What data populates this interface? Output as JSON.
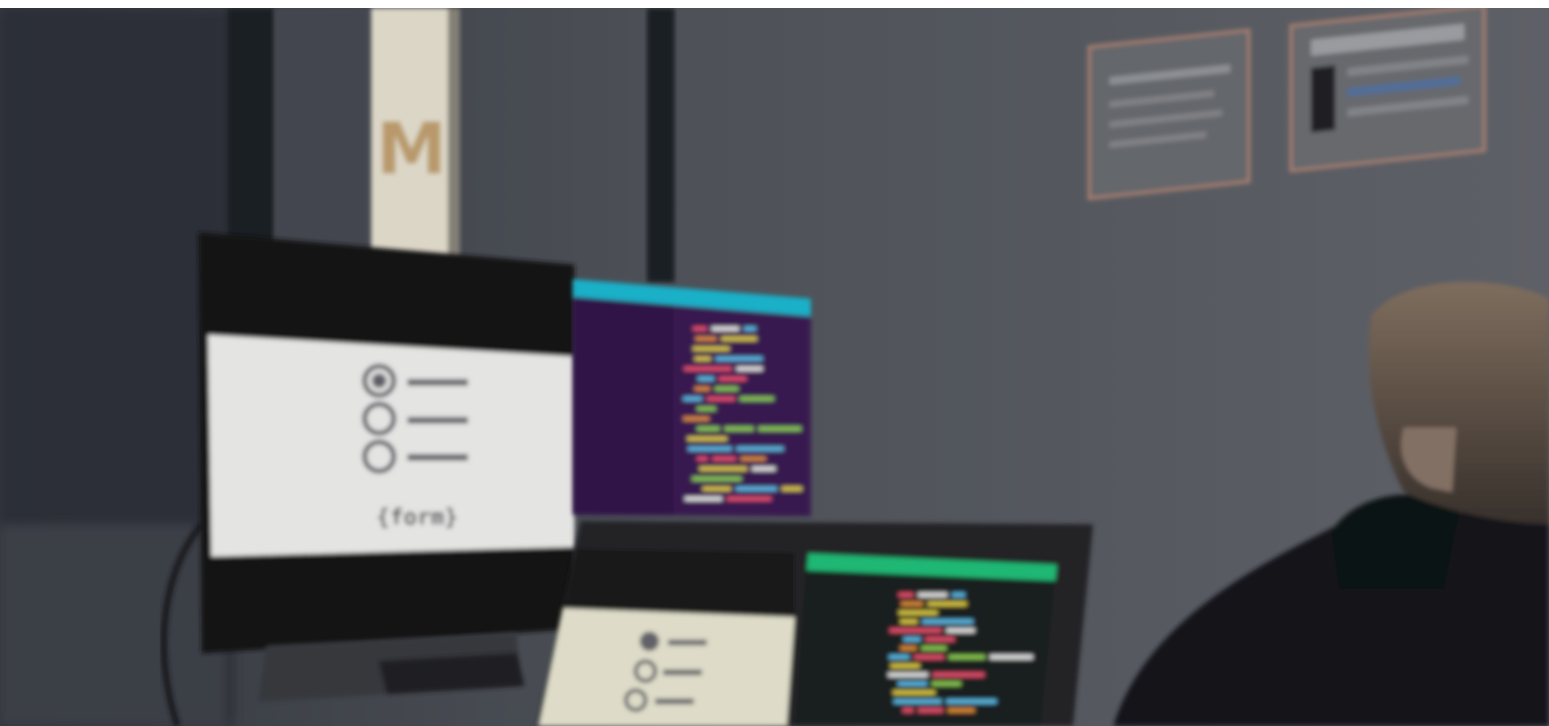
{
  "photo": {
    "sign_letter": "M",
    "monitor_slide_caption": "{form}",
    "colors": {
      "wall": "#5d6066",
      "wall_dark": "#2c3038",
      "pillar": "#23262c",
      "sign_panel": "#efe9d8",
      "sign_letter": "#c9a776",
      "slide_bg": "#f8f8f6",
      "slide_icon": "#666670",
      "editor_bg": "#3c1a57",
      "editor_header": "#1fbfd9",
      "laptop_editor_bg": "#1f2322",
      "laptop_editor_header": "#22c77e",
      "poster_frame": "#b78a7a"
    },
    "code_colors": [
      "#f4e04d",
      "#ff5a7a",
      "#9be15d",
      "#ffffff",
      "#f59c3c",
      "#6ad0ff"
    ]
  }
}
